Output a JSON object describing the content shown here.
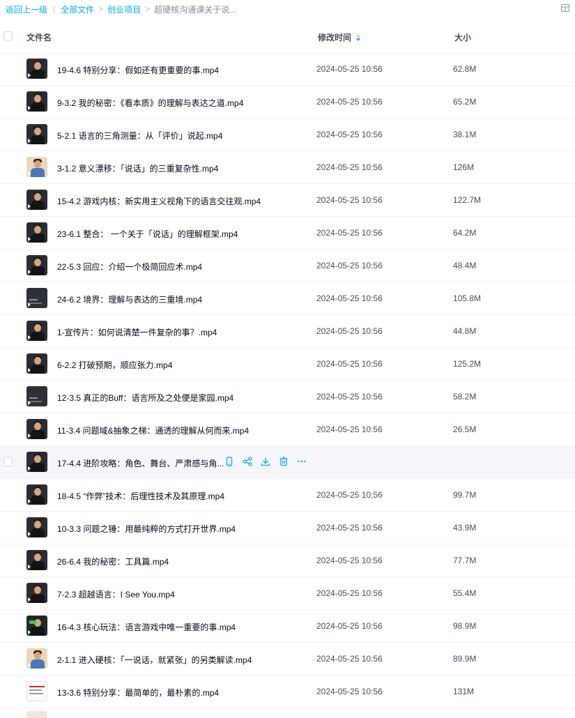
{
  "breadcrumb": {
    "back_label": "返回上一级",
    "separator": "|",
    "items": [
      "全部文件",
      "创业项目"
    ],
    "current": "超硬核沟通课关于说..."
  },
  "colors": {
    "link": "#06a7ff",
    "text": "#03081a",
    "muted": "#454d5a",
    "hover_bg": "#f5f7fb",
    "action_icon": "#06a7ff"
  },
  "table": {
    "headers": {
      "name": "文件名",
      "time": "修改时间",
      "size": "大小"
    },
    "rows": [
      {
        "name": "19-4.6 特别分享：假如还有更重要的事.mp4",
        "time": "2024-05-25 10:56",
        "size": "62.8M",
        "thumb": "person"
      },
      {
        "name": "9-3.2 我的秘密：《看本质》的理解与表达之道.mp4",
        "time": "2024-05-25 10:56",
        "size": "65.2M",
        "thumb": "person"
      },
      {
        "name": "5-2.1 语言的三角测量：从「评价」说起.mp4",
        "time": "2024-05-25 10:56",
        "size": "38.1M",
        "thumb": "person"
      },
      {
        "name": "3-1.2 意义漂移：「说话」的三重复杂性.mp4",
        "time": "2024-05-25 10:56",
        "size": "126M",
        "thumb": "light"
      },
      {
        "name": "15-4.2 游戏内核：新实用主义视角下的语言交往观.mp4",
        "time": "2024-05-25 10:56",
        "size": "122.7M",
        "thumb": "person"
      },
      {
        "name": "23-6.1 整合： 一个关于「说话」的理解框架.mp4",
        "time": "2024-05-25 10:56",
        "size": "64.2M",
        "thumb": "person"
      },
      {
        "name": "22-5.3 回应：介绍一个极简回应术.mp4",
        "time": "2024-05-25 10:56",
        "size": "48.4M",
        "thumb": "person"
      },
      {
        "name": "24-6.2 境界：理解与表达的三重境.mp4",
        "time": "2024-05-25 10:56",
        "size": "105.8M",
        "thumb": "dark2"
      },
      {
        "name": "1-宣传片：如何说清楚一件复杂的事？.mp4",
        "time": "2024-05-25 10:56",
        "size": "44.8M",
        "thumb": "person"
      },
      {
        "name": "6-2.2 打破预期，顺应张力.mp4",
        "time": "2024-05-25 10:56",
        "size": "125.2M",
        "thumb": "person"
      },
      {
        "name": "12-3.5 真正的Buff：语言所及之处便是家园.mp4",
        "time": "2024-05-25 10:56",
        "size": "58.2M",
        "thumb": "dark2"
      },
      {
        "name": "11-3.4 问题域&抽象之梯：通透的理解从何而来.mp4",
        "time": "2024-05-25 10:56",
        "size": "26.5M",
        "thumb": "person"
      },
      {
        "name": "17-4.4 进阶攻略：角色、舞台、严肃感与角...",
        "time": "",
        "size": "",
        "thumb": "person",
        "hover": true
      },
      {
        "name": "18-4.5 “作弊”技术：后理性技术及其原理.mp4",
        "time": "2024-05-25 10:56",
        "size": "99.7M",
        "thumb": "person"
      },
      {
        "name": "10-3.3 问题之锤：用最纯粹的方式打开世界.mp4",
        "time": "2024-05-25 10:56",
        "size": "43.9M",
        "thumb": "person"
      },
      {
        "name": "26-6.4 我的秘密：工具篇.mp4",
        "time": "2024-05-25 10:56",
        "size": "77.7M",
        "thumb": "person"
      },
      {
        "name": "7-2.3 超越语言：I See You.mp4",
        "time": "2024-05-25 10:56",
        "size": "55.4M",
        "thumb": "person"
      },
      {
        "name": "16-4.3 核心玩法：语言游戏中唯一重要的事.mp4",
        "time": "2024-05-25 10:56",
        "size": "98.9M",
        "thumb": "green"
      },
      {
        "name": "2-1.1 进入硬核：「一说话，就紧张」的另类解读.mp4",
        "time": "2024-05-25 10:56",
        "size": "89.9M",
        "thumb": "light"
      },
      {
        "name": "13-3.6 特别分享：最简单的，最朴素的.mp4",
        "time": "2024-05-25 10:56",
        "size": "131M",
        "thumb": "slide"
      }
    ]
  },
  "row_actions": [
    "phone-icon",
    "share-icon",
    "download-icon",
    "trash-icon",
    "more-icon"
  ]
}
